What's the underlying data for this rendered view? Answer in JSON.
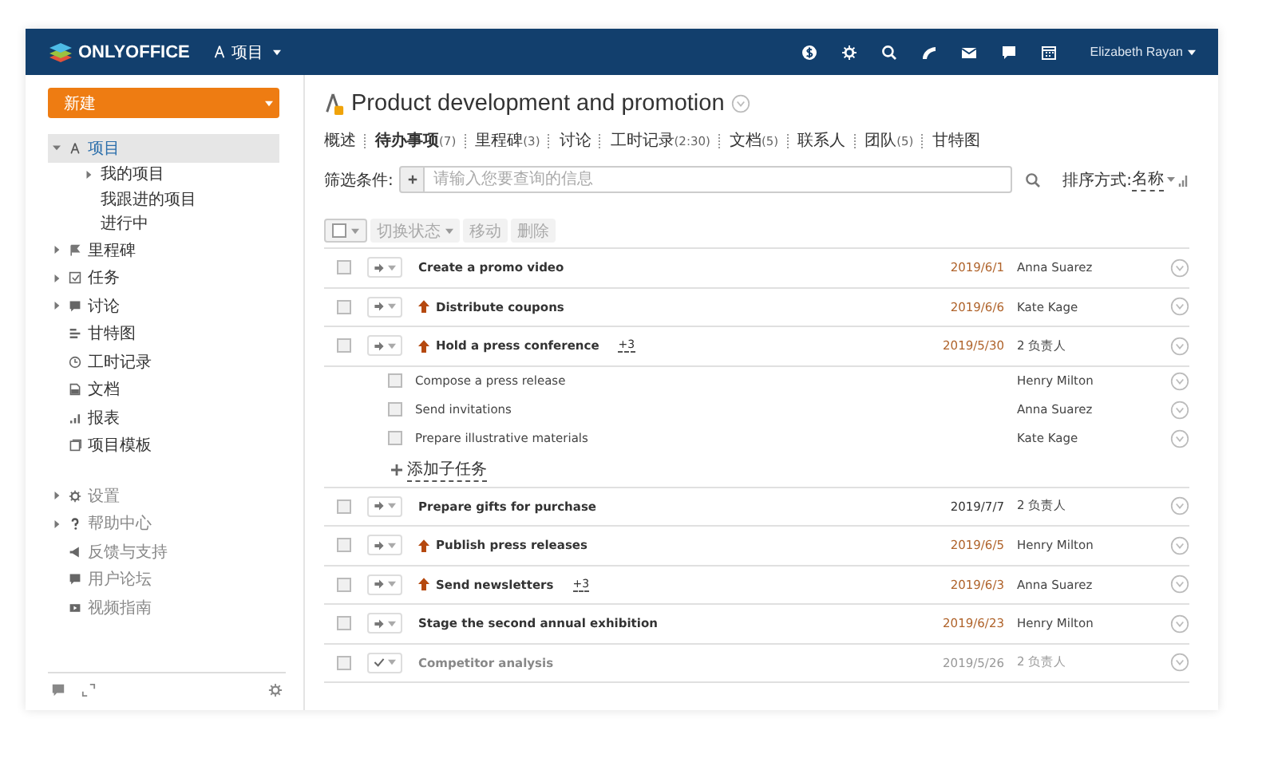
{
  "header": {
    "logo": "ONLYOFFICE",
    "module": "项目",
    "user": "Elizabeth Rayan"
  },
  "sidebar": {
    "create_button": "新建",
    "items": [
      {
        "label": "项目",
        "expanded": true,
        "selected": true,
        "children": [
          {
            "label": "我的项目",
            "expanded": false
          },
          {
            "label": "我跟进的项目"
          },
          {
            "label": "进行中"
          }
        ]
      },
      {
        "label": "里程碑",
        "expanded": false,
        "selected": false
      },
      {
        "label": "任务",
        "expanded": false,
        "selected": false
      },
      {
        "label": "讨论",
        "expanded": false,
        "selected": false
      },
      {
        "label": "甘特图",
        "selected": false
      },
      {
        "label": "工时记录",
        "selected": false
      },
      {
        "label": "文档",
        "selected": false
      },
      {
        "label": "报表",
        "selected": false
      },
      {
        "label": "项目模板",
        "selected": false
      }
    ],
    "support_items": [
      {
        "label": "设置",
        "expanded": false
      },
      {
        "label": "帮助中心",
        "expanded": false
      },
      {
        "label": "反馈与支持"
      },
      {
        "label": "用户论坛"
      },
      {
        "label": "视频指南"
      }
    ]
  },
  "project": {
    "title": "Product development and promotion"
  },
  "tabs": [
    {
      "label": "概述",
      "selected": false
    },
    {
      "label": "待办事项",
      "count": "(7)",
      "selected": true
    },
    {
      "label": "里程碑",
      "count": "(3)",
      "selected": false
    },
    {
      "label": "讨论",
      "selected": false
    },
    {
      "label": "工时记录",
      "count": "(2:30)",
      "selected": false
    },
    {
      "label": "文档",
      "count": "(5)",
      "selected": false
    },
    {
      "label": "联系人",
      "selected": false
    },
    {
      "label": "团队",
      "count": "(5)",
      "selected": false
    },
    {
      "label": "甘特图",
      "selected": false
    }
  ],
  "filter": {
    "label": "筛选条件:",
    "placeholder": "请输入您要查询的信息",
    "sort_label": "排序方式:",
    "sort_value": "名称"
  },
  "toolbar": {
    "buttons": [
      "切换状态",
      "移动",
      "删除"
    ]
  },
  "tasks": [
    {
      "kind": "task",
      "checked": false,
      "title": "Create a promo video",
      "high_priority": false,
      "date": "2019/6/1",
      "overdue": true,
      "assignee": "Anna Suarez",
      "closed": false
    },
    {
      "kind": "task",
      "checked": false,
      "title": "Distribute coupons",
      "high_priority": true,
      "date": "2019/6/6",
      "overdue": true,
      "assignee": "Kate Kage",
      "closed": false
    },
    {
      "kind": "task",
      "checked": false,
      "title": "Hold a press conference",
      "high_priority": true,
      "subtasks": "+3",
      "date": "2019/5/30",
      "overdue": true,
      "assignee": "2 负责人",
      "closed": false
    },
    {
      "kind": "subtask",
      "checked": false,
      "title": "Compose a press release",
      "assignee": "Henry Milton"
    },
    {
      "kind": "subtask",
      "checked": false,
      "title": "Send invitations",
      "assignee": "Anna Suarez"
    },
    {
      "kind": "subtask",
      "checked": false,
      "title": "Prepare illustrative materials",
      "assignee": "Kate Kage"
    },
    {
      "kind": "add",
      "title": "添加子任务"
    },
    {
      "kind": "task",
      "checked": false,
      "title": "Prepare gifts for purchase",
      "high_priority": false,
      "date": "2019/7/7",
      "overdue": false,
      "assignee": "2 负责人",
      "closed": false
    },
    {
      "kind": "task",
      "checked": false,
      "title": "Publish press releases",
      "high_priority": true,
      "date": "2019/6/5",
      "overdue": true,
      "assignee": "Henry Milton",
      "closed": false
    },
    {
      "kind": "task",
      "checked": false,
      "title": "Send newsletters",
      "high_priority": true,
      "subtasks": "+3",
      "date": "2019/6/3",
      "overdue": true,
      "assignee": "Anna Suarez",
      "closed": false
    },
    {
      "kind": "task",
      "checked": false,
      "title": "Stage the second annual exhibition",
      "high_priority": false,
      "date": "2019/6/23",
      "overdue": true,
      "assignee": "Henry Milton",
      "closed": false
    },
    {
      "kind": "task",
      "checked": false,
      "title": "Competitor analysis",
      "high_priority": false,
      "date": "2019/5/26",
      "overdue": false,
      "assignee": "2 负责人",
      "closed": true
    }
  ]
}
